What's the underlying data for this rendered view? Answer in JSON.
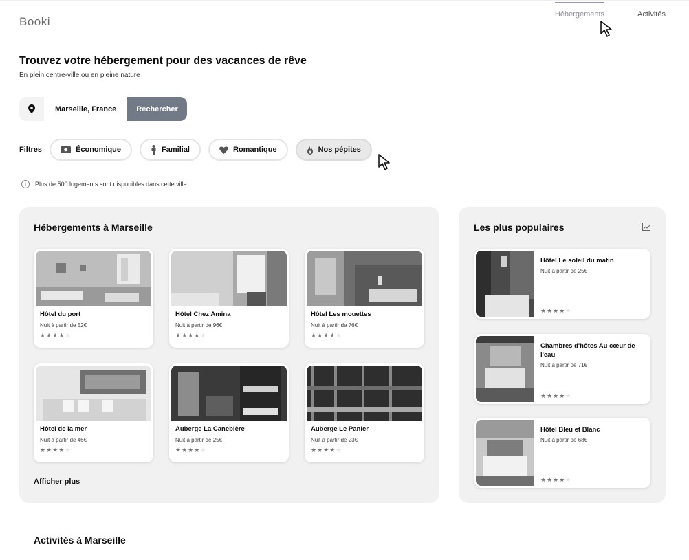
{
  "header": {
    "logo": "Booki",
    "nav": [
      {
        "label": "Hébergements",
        "active": true
      },
      {
        "label": "Activités",
        "active": false
      }
    ]
  },
  "hero": {
    "title": "Trouvez votre hébergement pour des vacances de rêve",
    "subtitle": "En plein centre-ville ou en pleine nature"
  },
  "search": {
    "location": "Marseille, France",
    "button": "Rechercher",
    "icon": "map-pin-icon"
  },
  "filters": {
    "label": "Filtres",
    "chips": [
      {
        "label": "Économique",
        "icon": "money-icon",
        "selected": false
      },
      {
        "label": "Familial",
        "icon": "person-icon",
        "selected": false
      },
      {
        "label": "Romantique",
        "icon": "heart-icon",
        "selected": false
      },
      {
        "label": "Nos pépites",
        "icon": "fire-icon",
        "selected": true
      }
    ]
  },
  "info": "Plus de 500 logements sont disponibles dans cette ville",
  "lodging": {
    "title": "Hébergements à Marseille",
    "cards": [
      {
        "name": "Hôtel du port",
        "price": "Nuit à partir de 52€",
        "rating": 4
      },
      {
        "name": "Hôtel Chez Amina",
        "price": "Nuit à partir de 96€",
        "rating": 4
      },
      {
        "name": "Hôtel Les mouettes",
        "price": "Nuit à partir de 76€",
        "rating": 4
      },
      {
        "name": "Hôtel de la mer",
        "price": "Nuit à partir de 46€",
        "rating": 4
      },
      {
        "name": "Auberge La Canebière",
        "price": "Nuit à partir de 25€",
        "rating": 4
      },
      {
        "name": "Auberge Le Panier",
        "price": "Nuit à partir de 23€",
        "rating": 4
      }
    ],
    "more": "Afficher plus"
  },
  "popular": {
    "title": "Les plus populaires",
    "icon": "trend-chart-icon",
    "items": [
      {
        "name": "Hôtel Le soleil du matin",
        "price": "Nuit à partir de 25€",
        "rating": 4
      },
      {
        "name": "Chambres d'hôtes Au cœur de l'eau",
        "price": "Nuit à partir de 71€",
        "rating": 4
      },
      {
        "name": "Hôtel Bleu et Blanc",
        "price": "Nuit à partir de 68€",
        "rating": 4
      }
    ]
  },
  "activities": {
    "title": "Activités à Marseille"
  },
  "colors": {
    "primary_button": "#737a87",
    "panel_bg": "#f1f1f1",
    "nav_active": "#9f9ab4"
  }
}
